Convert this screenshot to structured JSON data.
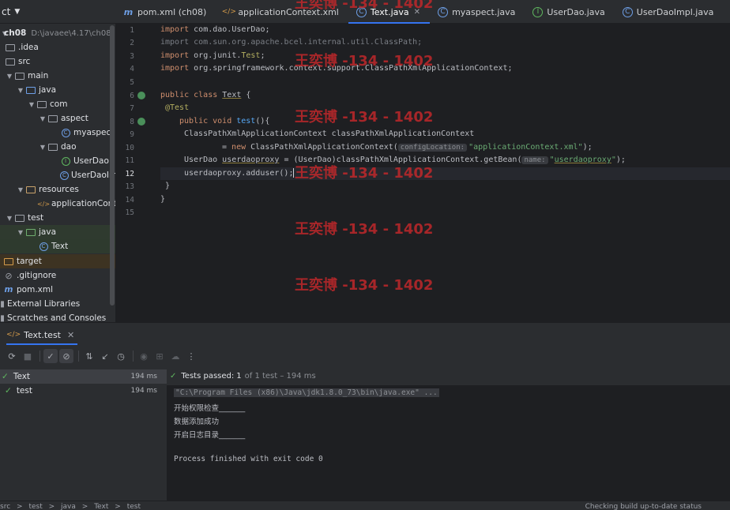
{
  "project": {
    "title": "ct"
  },
  "tabs": [
    {
      "label": "pom.xml (ch08)",
      "icon": "maven-icon"
    },
    {
      "label": "applicationContext.xml",
      "icon": "xml-icon"
    },
    {
      "label": "Text.java",
      "icon": "class-icon",
      "active": true
    },
    {
      "label": "myaspect.java",
      "icon": "class-icon"
    },
    {
      "label": "UserDao.java",
      "icon": "interface-icon"
    },
    {
      "label": "UserDaoImpl.java",
      "icon": "class-icon"
    }
  ],
  "tree": [
    {
      "label": "ch08",
      "path": "D:\\javaee\\4.17\\ch08"
    },
    {
      "label": ".idea"
    },
    {
      "label": "src"
    },
    {
      "label": "main"
    },
    {
      "label": "java"
    },
    {
      "label": "com"
    },
    {
      "label": "aspect"
    },
    {
      "label": "myaspect"
    },
    {
      "label": "dao"
    },
    {
      "label": "UserDao"
    },
    {
      "label": "UserDaoImpl"
    },
    {
      "label": "resources"
    },
    {
      "label": "applicationContext"
    },
    {
      "label": "test"
    },
    {
      "label": "java"
    },
    {
      "label": "Text"
    },
    {
      "label": "target"
    },
    {
      "label": ".gitignore"
    },
    {
      "label": "pom.xml"
    },
    {
      "label": "External Libraries"
    },
    {
      "label": "Scratches and Consoles"
    }
  ],
  "editor": {
    "line_numbers": [
      "1",
      "2",
      "3",
      "4",
      "5",
      "6",
      "7",
      "8",
      "9",
      "10",
      "11",
      "12",
      "13",
      "14",
      "15"
    ],
    "lines": {
      "l1a": "import ",
      "l1b": "com.dao.UserDao;",
      "l2": "import com.sun.org.apache.bcel.internal.util.ClassPath;",
      "l3a": "import ",
      "l3b": "org.junit.",
      "l3c": "Test",
      "l3d": ";",
      "l4a": "import ",
      "l4b": "org.springframework.context.support.ClassPathXmlApplicationContext;",
      "l6a": "public class ",
      "l6b": "Text",
      "l6c": " {",
      "l7": "@Test",
      "l8a": "public void ",
      "l8b": "test",
      "l8c": "(){",
      "l9": "ClassPathXmlApplicationContext classPathXmlApplicationContext",
      "l10a": "= ",
      "l10b": "new ",
      "l10c": "ClassPathXmlApplicationContext(",
      "l10hint": "configLocation:",
      "l10d": "\"applicationContext.xml\"",
      "l10e": ");",
      "l11a": "UserDao ",
      "l11b": "userdaoproxy",
      "l11c": " = (UserDao)classPathXmlApplicationContext.getBean(",
      "l11hint": "name:",
      "l11d": "\"",
      "l11e": "userdaoproxy",
      "l11f": "\"",
      "l11g": ");",
      "l12": "userdaoproxy.adduser();",
      "l13": "}",
      "l14": "}"
    }
  },
  "watermark": "王奕博 -134 - 1402",
  "run": {
    "tab_label": "Text.test",
    "test_tree": [
      {
        "label": "Text",
        "duration": "194 ms"
      },
      {
        "label": "test",
        "duration": "194 ms"
      }
    ],
    "passed_label": "Tests passed:",
    "passed_count": "1",
    "passed_rest": "of 1 test – 194 ms",
    "console": [
      "\"C:\\Program Files (x86)\\Java\\jdk1.8.0_73\\bin\\java.exe\" ...",
      "开始权限检查_______",
      "数据添加成功",
      "开启日志目录_______",
      "Process finished with exit code 0"
    ]
  },
  "status": {
    "crumbs": [
      "src",
      ">",
      "test",
      ">",
      "java",
      ">",
      "Text",
      ">",
      "test"
    ],
    "right": "Checking build up-to-date status"
  }
}
